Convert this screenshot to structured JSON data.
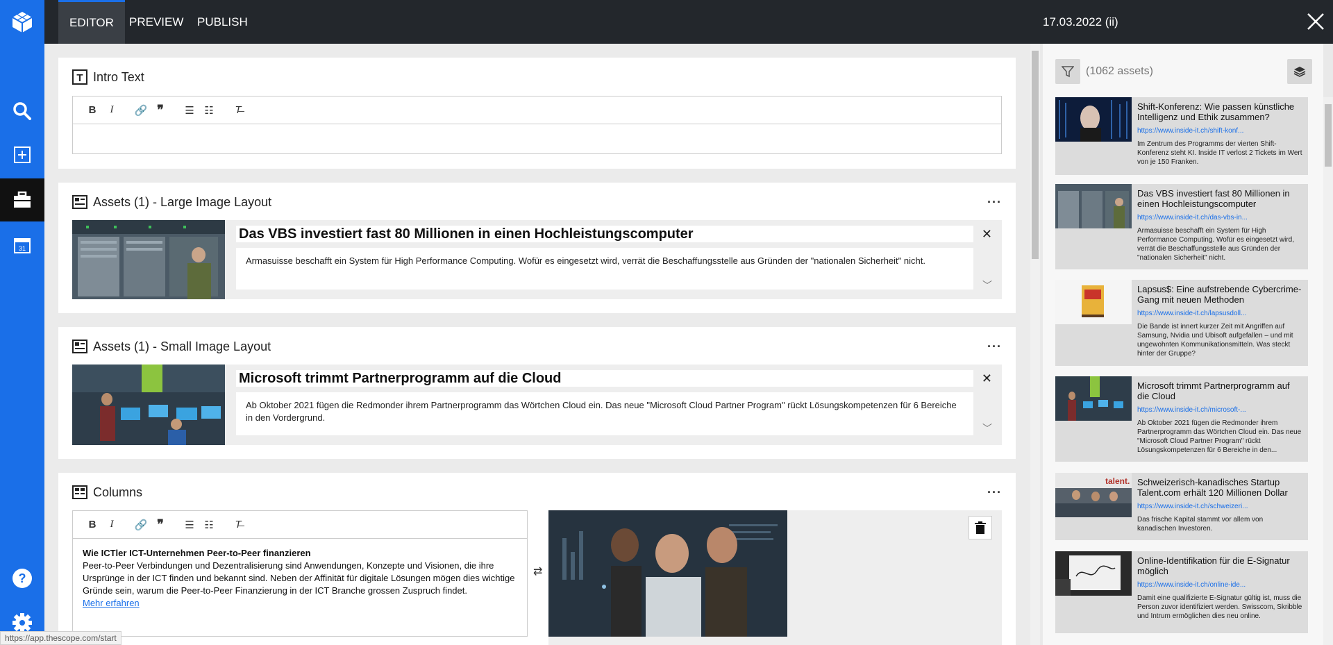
{
  "app": {
    "tabs": [
      {
        "label": "EDITOR"
      },
      {
        "label": "PREVIEW"
      },
      {
        "label": "PUBLISH"
      }
    ],
    "date": "17.03.2022 (ii)"
  },
  "editor": {
    "intro": {
      "title": "Intro Text"
    },
    "large": {
      "title": "Assets (1) - Large Image Layout",
      "asset_title": "Das VBS investiert fast 80 Millionen in einen Hochleistungscomputer",
      "asset_desc": "Armasuisse beschafft ein System für High Performance Computing. Wofür es eingesetzt wird, verrät die Beschaffungsstelle aus Gründen der \"nationalen Sicherheit\" nicht."
    },
    "small": {
      "title": "Assets (1) - Small Image Layout",
      "asset_title": "Microsoft trimmt Partnerprogramm auf die Cloud",
      "asset_desc": "Ab Oktober 2021 fügen die Redmonder ihrem Partnerprogramm das Wörtchen Cloud ein. Das neue \"Microsoft Cloud Partner Program\" rückt Lösungskompetenzen für 6 Bereiche in den Vordergrund."
    },
    "columns": {
      "title": "Columns",
      "heading": "Wie ICTler ICT-Unternehmen Peer-to-Peer finanzieren",
      "body": "Peer-to-Peer Verbindungen und Dezentralisierung sind Anwendungen, Konzepte und Visionen, die ihre Ursprünge in der ICT finden und bekannt sind. Neben der Affinität für digitale Lösungen mögen dies wichtige Gründe sein, warum die Peer-to-Peer Finanzierung in der ICT Branche grossen Zuspruch findet.",
      "link": "Mehr erfahren"
    }
  },
  "assets_panel": {
    "count": "(1062 assets)",
    "cards": [
      {
        "title": "Shift-Konferenz: Wie passen künstliche Intelligenz und Ethik zusammen?",
        "url": "https://www.inside-it.ch/shift-konf...",
        "desc": "Im Zentrum des Programms der vierten Shift-Konferenz steht KI. Inside IT verlost 2 Tickets im Wert von je 150 Franken."
      },
      {
        "title": "Das VBS investiert fast 80 Millionen in einen Hochleistungscomputer",
        "url": "https://www.inside-it.ch/das-vbs-in...",
        "desc": "Armasuisse beschafft ein System für High Performance Computing. Wofür es eingesetzt wird, verrät die Beschaffungsstelle aus Gründen der \"nationalen Sicherheit\" nicht."
      },
      {
        "title": "Lapsus$: Eine aufstrebende Cybercrime-Gang mit neuen Methoden",
        "url": "https://www.inside-it.ch/lapsusdoll...",
        "desc": "Die Bande ist innert kurzer Zeit mit Angriffen auf Samsung, Nvidia und Ubisoft aufgefallen – und mit ungewohnten Kommunikationsmitteln. Was steckt hinter der Gruppe?"
      },
      {
        "title": "Microsoft trimmt Partnerprogramm auf die Cloud",
        "url": "https://www.inside-it.ch/microsoft-...",
        "desc": "Ab Oktober 2021 fügen die Redmonder ihrem Partnerprogramm das Wörtchen Cloud ein. Das neue \"Microsoft Cloud Partner Program\" rückt Lösungskompetenzen für 6 Bereiche in den..."
      },
      {
        "title": "Schweizerisch-kanadisches Startup Talent.com erhält 120 Millionen Dollar",
        "url": "https://www.inside-it.ch/schweizeri...",
        "desc": "Das frische Kapital stammt vor allem von kanadischen Investoren."
      },
      {
        "title": "Online-Identifikation für die E-Signatur möglich",
        "url": "https://www.inside-it.ch/online-ide...",
        "desc": "Damit eine qualifizierte E-Signatur gültig ist, muss die Person zuvor identifiziert werden. Swisscom, Skribble und Intrum ermöglichen dies neu online."
      }
    ]
  },
  "status_url": "https://app.thescope.com/start"
}
